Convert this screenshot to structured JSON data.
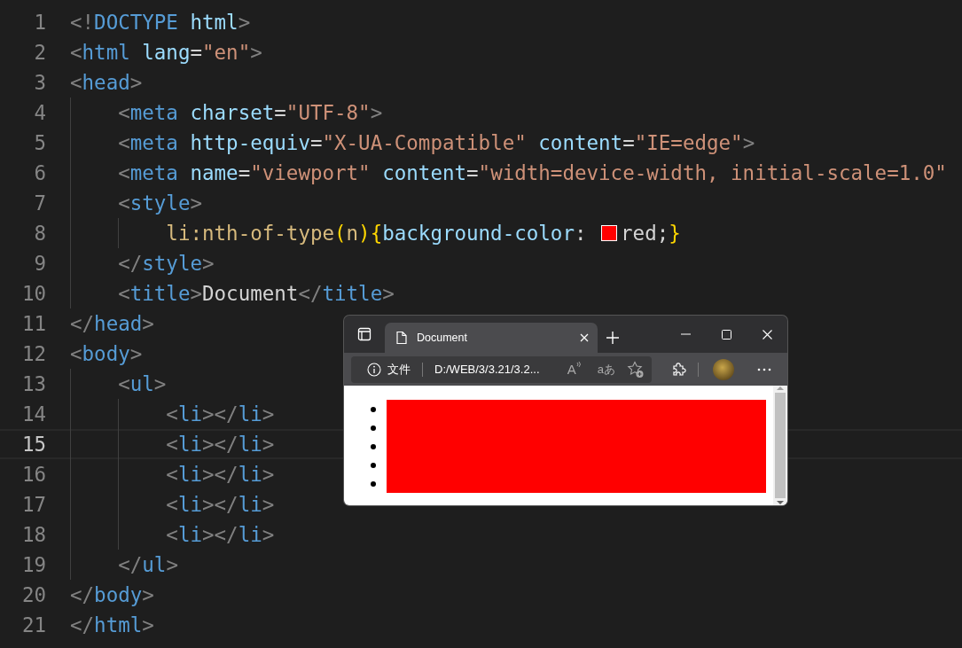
{
  "editor": {
    "lines": [
      {
        "number": "1",
        "current": false,
        "tokens": [
          {
            "kind": "punct",
            "text": "<!"
          },
          {
            "kind": "tag",
            "text": "DOCTYPE "
          },
          {
            "kind": "attr",
            "text": "html"
          },
          {
            "kind": "punct",
            "text": ">"
          }
        ]
      },
      {
        "number": "2",
        "current": false,
        "tokens": [
          {
            "kind": "punct",
            "text": "<"
          },
          {
            "kind": "tag",
            "text": "html "
          },
          {
            "kind": "attr",
            "text": "lang"
          },
          {
            "kind": "plain",
            "text": "="
          },
          {
            "kind": "string",
            "text": "\"en\""
          },
          {
            "kind": "punct",
            "text": ">"
          }
        ]
      },
      {
        "number": "3",
        "current": false,
        "tokens": [
          {
            "kind": "punct",
            "text": "<"
          },
          {
            "kind": "tag",
            "text": "head"
          },
          {
            "kind": "punct",
            "text": ">"
          }
        ]
      },
      {
        "number": "4",
        "current": false,
        "tokens": [
          {
            "kind": "punct",
            "text": "    <"
          },
          {
            "kind": "tag",
            "text": "meta "
          },
          {
            "kind": "attr",
            "text": "charset"
          },
          {
            "kind": "plain",
            "text": "="
          },
          {
            "kind": "string",
            "text": "\"UTF-8\""
          },
          {
            "kind": "punct",
            "text": ">"
          }
        ]
      },
      {
        "number": "5",
        "current": false,
        "tokens": [
          {
            "kind": "punct",
            "text": "    <"
          },
          {
            "kind": "tag",
            "text": "meta "
          },
          {
            "kind": "attr",
            "text": "http-equiv"
          },
          {
            "kind": "plain",
            "text": "="
          },
          {
            "kind": "string",
            "text": "\"X-UA-Compatible\" "
          },
          {
            "kind": "attr",
            "text": "content"
          },
          {
            "kind": "plain",
            "text": "="
          },
          {
            "kind": "string",
            "text": "\"IE=edge\""
          },
          {
            "kind": "punct",
            "text": ">"
          }
        ]
      },
      {
        "number": "6",
        "current": false,
        "tokens": [
          {
            "kind": "punct",
            "text": "    <"
          },
          {
            "kind": "tag",
            "text": "meta "
          },
          {
            "kind": "attr",
            "text": "name"
          },
          {
            "kind": "plain",
            "text": "="
          },
          {
            "kind": "string",
            "text": "\"viewport\" "
          },
          {
            "kind": "attr",
            "text": "content"
          },
          {
            "kind": "plain",
            "text": "="
          },
          {
            "kind": "string",
            "text": "\"width=device-width, initial-scale=1.0\""
          }
        ]
      },
      {
        "number": "7",
        "current": false,
        "tokens": [
          {
            "kind": "punct",
            "text": "    <"
          },
          {
            "kind": "tag",
            "text": "style"
          },
          {
            "kind": "punct",
            "text": ">"
          }
        ]
      },
      {
        "number": "8",
        "current": false,
        "tokens": [
          {
            "kind": "selector",
            "text": "        li:nth-of-type"
          },
          {
            "kind": "bracket",
            "text": "("
          },
          {
            "kind": "selector",
            "text": "n"
          },
          {
            "kind": "bracket",
            "text": "){"
          },
          {
            "kind": "attr",
            "text": "background-color"
          },
          {
            "kind": "plain",
            "text": ": "
          },
          {
            "kind": "swatch",
            "color": "#ff0000"
          },
          {
            "kind": "plain",
            "text": "red;"
          },
          {
            "kind": "bracket",
            "text": "}"
          }
        ]
      },
      {
        "number": "9",
        "current": false,
        "tokens": [
          {
            "kind": "punct",
            "text": "    </"
          },
          {
            "kind": "tag",
            "text": "style"
          },
          {
            "kind": "punct",
            "text": ">"
          }
        ]
      },
      {
        "number": "10",
        "current": false,
        "tokens": [
          {
            "kind": "punct",
            "text": "    <"
          },
          {
            "kind": "tag",
            "text": "title"
          },
          {
            "kind": "punct",
            "text": ">"
          },
          {
            "kind": "plain",
            "text": "Document"
          },
          {
            "kind": "punct",
            "text": "</"
          },
          {
            "kind": "tag",
            "text": "title"
          },
          {
            "kind": "punct",
            "text": ">"
          }
        ]
      },
      {
        "number": "11",
        "current": false,
        "tokens": [
          {
            "kind": "punct",
            "text": "</"
          },
          {
            "kind": "tag",
            "text": "head"
          },
          {
            "kind": "punct",
            "text": ">"
          }
        ]
      },
      {
        "number": "12",
        "current": false,
        "tokens": [
          {
            "kind": "punct",
            "text": "<"
          },
          {
            "kind": "tag",
            "text": "body"
          },
          {
            "kind": "punct",
            "text": ">"
          }
        ]
      },
      {
        "number": "13",
        "current": false,
        "tokens": [
          {
            "kind": "punct",
            "text": "    <"
          },
          {
            "kind": "tag",
            "text": "ul"
          },
          {
            "kind": "punct",
            "text": ">"
          }
        ]
      },
      {
        "number": "14",
        "current": false,
        "tokens": [
          {
            "kind": "punct",
            "text": "        <"
          },
          {
            "kind": "tag",
            "text": "li"
          },
          {
            "kind": "punct",
            "text": "></"
          },
          {
            "kind": "tag",
            "text": "li"
          },
          {
            "kind": "punct",
            "text": ">"
          }
        ]
      },
      {
        "number": "15",
        "current": true,
        "tokens": [
          {
            "kind": "punct",
            "text": "        <"
          },
          {
            "kind": "tag",
            "text": "li"
          },
          {
            "kind": "punct",
            "text": "></"
          },
          {
            "kind": "tag",
            "text": "li"
          },
          {
            "kind": "punct",
            "text": ">"
          }
        ]
      },
      {
        "number": "16",
        "current": false,
        "tokens": [
          {
            "kind": "punct",
            "text": "        <"
          },
          {
            "kind": "tag",
            "text": "li"
          },
          {
            "kind": "punct",
            "text": "></"
          },
          {
            "kind": "tag",
            "text": "li"
          },
          {
            "kind": "punct",
            "text": ">"
          }
        ]
      },
      {
        "number": "17",
        "current": false,
        "tokens": [
          {
            "kind": "punct",
            "text": "        <"
          },
          {
            "kind": "tag",
            "text": "li"
          },
          {
            "kind": "punct",
            "text": "></"
          },
          {
            "kind": "tag",
            "text": "li"
          },
          {
            "kind": "punct",
            "text": ">"
          }
        ]
      },
      {
        "number": "18",
        "current": false,
        "tokens": [
          {
            "kind": "punct",
            "text": "        <"
          },
          {
            "kind": "tag",
            "text": "li"
          },
          {
            "kind": "punct",
            "text": "></"
          },
          {
            "kind": "tag",
            "text": "li"
          },
          {
            "kind": "punct",
            "text": ">"
          }
        ]
      },
      {
        "number": "19",
        "current": false,
        "tokens": [
          {
            "kind": "punct",
            "text": "    </"
          },
          {
            "kind": "tag",
            "text": "ul"
          },
          {
            "kind": "punct",
            "text": ">"
          }
        ]
      },
      {
        "number": "20",
        "current": false,
        "tokens": [
          {
            "kind": "punct",
            "text": "</"
          },
          {
            "kind": "tag",
            "text": "body"
          },
          {
            "kind": "punct",
            "text": ">"
          }
        ]
      },
      {
        "number": "21",
        "current": false,
        "tokens": [
          {
            "kind": "punct",
            "text": "</"
          },
          {
            "kind": "tag",
            "text": "html"
          },
          {
            "kind": "punct",
            "text": ">"
          }
        ]
      }
    ]
  },
  "browser": {
    "tabs": [
      {
        "title": "Document",
        "selected": true
      }
    ],
    "address": {
      "scheme_label": "文件",
      "url": "D:/WEB/3/3.21/3.2..."
    },
    "read_aloud": "A",
    "translate": "aあ",
    "page": {
      "list_items": [
        {
          "color": "#ff0000"
        },
        {
          "color": "#ff0000"
        },
        {
          "color": "#ff0000"
        },
        {
          "color": "#ff0000"
        },
        {
          "color": "#ff0000"
        }
      ]
    }
  }
}
